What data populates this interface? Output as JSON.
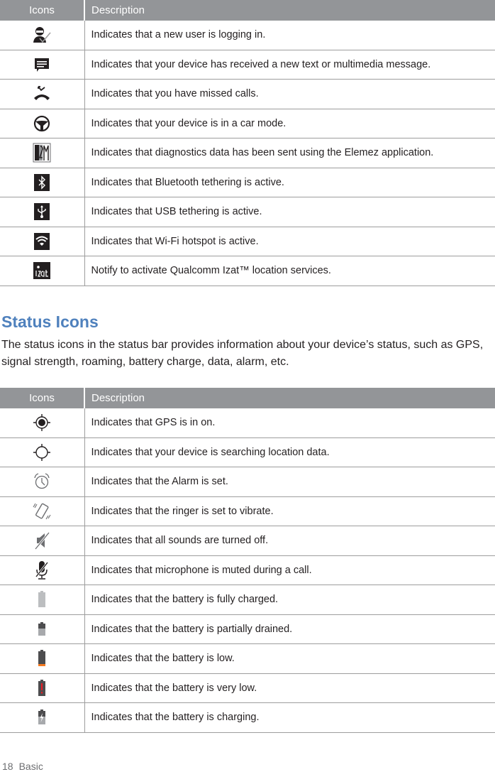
{
  "notification_table": {
    "headers": {
      "icons": "Icons",
      "description": "Description"
    },
    "rows": [
      {
        "icon": "new-user-login-icon",
        "description": "Indicates that a new user is logging  in."
      },
      {
        "icon": "new-message-icon",
        "description": "Indicates that your device has received a new text or multimedia  message."
      },
      {
        "icon": "missed-call-icon",
        "description": "Indicates that you have missed calls."
      },
      {
        "icon": "car-mode-icon",
        "description": "Indicates that your device is in a car  mode."
      },
      {
        "icon": "elemez-diagnostics-icon",
        "description": "Indicates that diagnostics data has been sent using the Elemez  application."
      },
      {
        "icon": "bluetooth-tethering-icon",
        "description": "Indicates that Bluetooth tethering is  active."
      },
      {
        "icon": "usb-tethering-icon",
        "description": "Indicates that USB tethering is  active."
      },
      {
        "icon": "wifi-hotspot-icon",
        "description": "Indicates that Wi-Fi hotspot is  active."
      },
      {
        "icon": "izat-location-icon",
        "description": "Notify to activate Qualcomm Izat™ location  services."
      }
    ]
  },
  "status_section": {
    "title": "Status Icons",
    "intro": "The status icons in the status bar provides information about your device’s status, such as GPS, signal strength, roaming, battery charge, data, alarm,  etc."
  },
  "status_table": {
    "headers": {
      "icons": "Icons",
      "description": "Description"
    },
    "rows": [
      {
        "icon": "gps-on-icon",
        "description": "Indicates that GPS is in on."
      },
      {
        "icon": "gps-searching-icon",
        "description": "Indicates that your device is searching location  data."
      },
      {
        "icon": "alarm-icon",
        "description": "Indicates that the Alarm is  set."
      },
      {
        "icon": "vibrate-icon",
        "description": "Indicates that the ringer is set to  vibrate."
      },
      {
        "icon": "sound-off-icon",
        "description": "Indicates that all sounds are turned  off."
      },
      {
        "icon": "mic-muted-icon",
        "description": "Indicates that microphone is muted during a call."
      },
      {
        "icon": "battery-full-icon",
        "description": "Indicates that the battery is fully  charged."
      },
      {
        "icon": "battery-partial-icon",
        "description": "Indicates that the battery is partially  drained."
      },
      {
        "icon": "battery-low-icon",
        "description": "Indicates that the battery is  low."
      },
      {
        "icon": "battery-very-low-icon",
        "description": "Indicates that the battery is very  low."
      },
      {
        "icon": "battery-charging-icon",
        "description": "Indicates that the battery is  charging."
      }
    ]
  },
  "colors": {
    "header_bg": "#939598",
    "title_blue": "#4f81bd",
    "battery_low_orange": "#f47920",
    "battery_critical_red": "#ed1c24"
  },
  "footer": {
    "page_number": "18",
    "section": "Basic"
  }
}
